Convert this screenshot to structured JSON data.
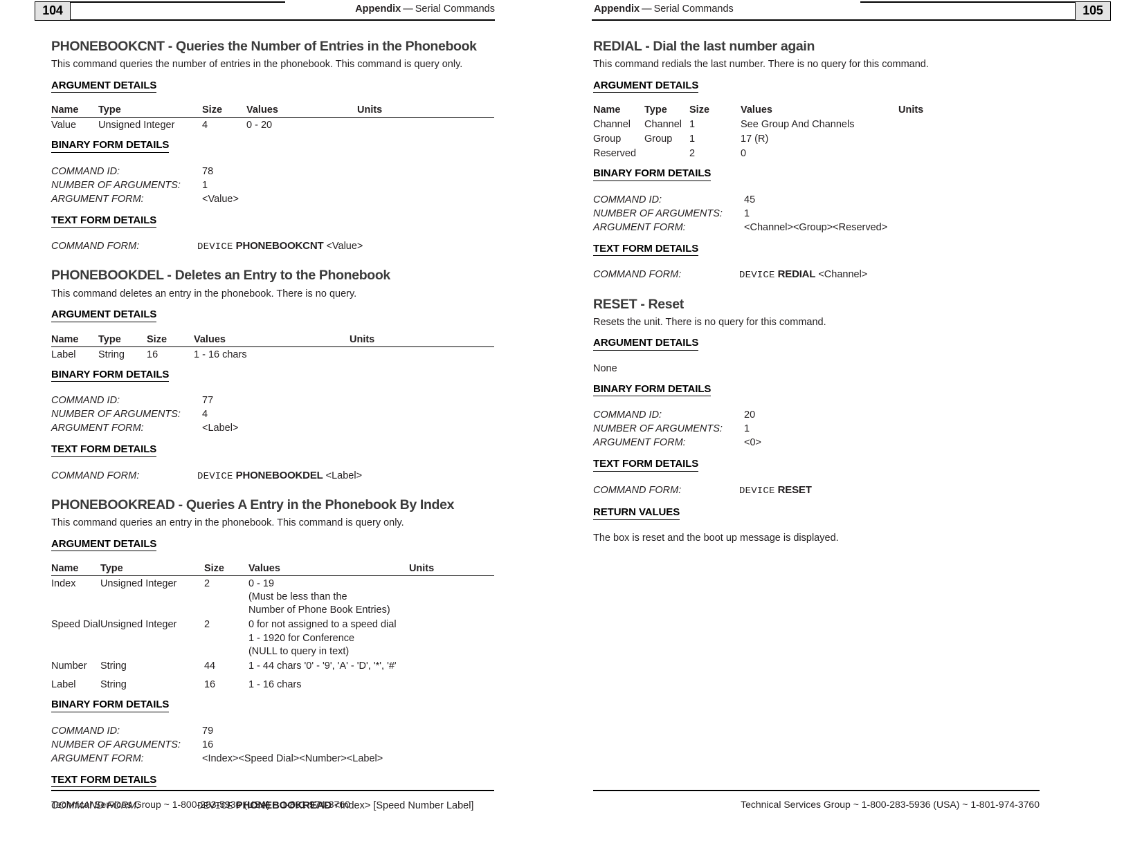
{
  "spread": {
    "left_page": {
      "page_number": "104",
      "running_head_bold": "Appendix",
      "running_head_sep": "—",
      "running_head_rest": "Serial Commands",
      "footer": "Technical Services Group ~ 1-800-283-5936 (USA) ~ 1-801-974-3760",
      "sections": [
        {
          "title": "PHONEBOOKCNT - Queries the Number of Entries in the Phonebook",
          "description": "This command queries the number of entries in the phonebook. This command is query only.",
          "argument_details_heading": "ARGUMENT DETAILS",
          "table": {
            "headers": [
              "Name",
              "Type",
              "Size",
              "Values",
              "Units"
            ],
            "rows": [
              {
                "name": "Value",
                "type": "Unsigned Integer",
                "size": "4",
                "values": [
                  "0 - 20"
                ],
                "units": ""
              }
            ]
          },
          "binary_heading": "BINARY FORM DETAILS",
          "binary": {
            "command_id_label": "COMMAND ID:",
            "command_id_value": "78",
            "num_args_label": "NUMBER OF ARGUMENTS:",
            "num_args_value": "1",
            "arg_form_label": "ARGUMENT FORM:",
            "arg_form_value": "<Value>"
          },
          "text_heading": "TEXT FORM DETAILS",
          "text_form": {
            "command_form_label": "COMMAND FORM:",
            "device_word": "DEVICE",
            "command_name": "PHONEBOOKCNT",
            "arguments": "<Value>"
          }
        },
        {
          "title": "PHONEBOOKDEL - Deletes an Entry to the Phonebook",
          "description": "This command deletes an entry in the phonebook.  There is no query.",
          "argument_details_heading": "ARGUMENT DETAILS",
          "table": {
            "headers": [
              "Name",
              "Type",
              "Size",
              "Values",
              "Units"
            ],
            "rows": [
              {
                "name": "Label",
                "type": "String",
                "size": "16",
                "values": [
                  "1 - 16 chars"
                ],
                "units": ""
              }
            ]
          },
          "binary_heading": "BINARY FORM DETAILS",
          "binary": {
            "command_id_label": "COMMAND ID:",
            "command_id_value": "77",
            "num_args_label": "NUMBER OF ARGUMENTS:",
            "num_args_value": "4",
            "arg_form_label": "ARGUMENT FORM:",
            "arg_form_value": "<Label>"
          },
          "text_heading": "TEXT FORM DETAILS",
          "text_form": {
            "command_form_label": "COMMAND FORM:",
            "device_word": "DEVICE",
            "command_name": "PHONEBOOKDEL",
            "arguments": "<Label>"
          }
        },
        {
          "title": "PHONEBOOKREAD - Queries A Entry in the Phonebook By Index",
          "description": "This command queries an entry in the phonebook.  This command is query only.",
          "argument_details_heading": "ARGUMENT DETAILS",
          "table": {
            "headers": [
              "Name",
              "Type",
              "Size",
              "Values",
              "Units"
            ],
            "rows": [
              {
                "name": "Index",
                "type": "Unsigned Integer",
                "size": "2",
                "values": [
                  "0 - 19",
                  "(Must be less than the",
                  "Number of Phone Book Entries)"
                ],
                "units": ""
              },
              {
                "name": "Speed Dial",
                "type": "Unsigned Integer",
                "size": "2",
                "values": [
                  "0 for not assigned to a speed dial",
                  "1 - 1920 for Conference",
                  "(NULL to query in text)"
                ],
                "units": ""
              },
              {
                "name": "Number",
                "type": "String",
                "size": "44",
                "values": [
                  "1 - 44 chars '0' - '9', 'A' - 'D', '*', '#'"
                ],
                "units": ""
              },
              {
                "name": "Label",
                "type": "String",
                "size": "16",
                "values": [
                  "1 - 16 chars"
                ],
                "units": ""
              }
            ]
          },
          "binary_heading": "BINARY FORM DETAILS",
          "binary": {
            "command_id_label": "COMMAND ID:",
            "command_id_value": "79",
            "num_args_label": "NUMBER OF ARGUMENTS:",
            "num_args_value": "16",
            "arg_form_label": "ARGUMENT FORM:",
            "arg_form_value": "<Index><Speed Dial><Number><Label>"
          },
          "text_heading": "TEXT FORM DETAILS",
          "text_form": {
            "command_form_label": "COMMAND FORM:",
            "device_word": "DEVICE",
            "command_name": "PHONEBOOKREAD",
            "arguments": "<Index> [Speed Number Label]"
          }
        }
      ]
    },
    "right_page": {
      "page_number": "105",
      "running_head_bold": "Appendix",
      "running_head_sep": "—",
      "running_head_rest": "Serial Commands",
      "footer": "Technical Services Group ~ 1-800-283-5936 (USA) ~ 1-801-974-3760",
      "sections": [
        {
          "title": "REDIAL - Dial the last number again",
          "description": "This command redials the last number. There is no query for this command.",
          "argument_details_heading": "ARGUMENT DETAILS",
          "table": {
            "headers": [
              "Name",
              "Type",
              "Size",
              "Values",
              "Units"
            ],
            "rows": [
              {
                "name": "Channel",
                "type": "Channel",
                "size": "1",
                "values": [
                  "See Group And Channels"
                ],
                "units": ""
              },
              {
                "name": "Group",
                "type": "Group",
                "size": "1",
                "values": [
                  "17 (R)"
                ],
                "units": ""
              },
              {
                "name": "Reserved",
                "type": "",
                "size": "2",
                "values": [
                  "0"
                ],
                "units": ""
              }
            ]
          },
          "binary_heading": "BINARY FORM DETAILS",
          "binary": {
            "command_id_label": "COMMAND ID:",
            "command_id_value": "45",
            "num_args_label": "NUMBER OF ARGUMENTS:",
            "num_args_value": "1",
            "arg_form_label": "ARGUMENT FORM:",
            "arg_form_value": "<Channel><Group><Reserved>"
          },
          "text_heading": "TEXT FORM DETAILS",
          "text_form": {
            "command_form_label": "COMMAND FORM:",
            "device_word": "DEVICE",
            "command_name": "REDIAL",
            "arguments": "<Channel>"
          }
        },
        {
          "title": "RESET - Reset",
          "description": "Resets the unit. There is no query for this command.",
          "argument_details_heading": "ARGUMENT DETAILS",
          "argument_details_none": "None",
          "binary_heading": "BINARY FORM DETAILS",
          "binary": {
            "command_id_label": "COMMAND ID:",
            "command_id_value": "20",
            "num_args_label": "NUMBER OF ARGUMENTS:",
            "num_args_value": "1",
            "arg_form_label": "ARGUMENT FORM:",
            "arg_form_value": "<0>"
          },
          "text_heading": "TEXT FORM DETAILS",
          "text_form": {
            "command_form_label": "COMMAND FORM:",
            "device_word": "DEVICE",
            "command_name": "RESET",
            "arguments": ""
          },
          "return_values_heading": "RETURN VALUES",
          "return_values_text": "The box is reset and the boot up message is displayed."
        }
      ]
    }
  }
}
